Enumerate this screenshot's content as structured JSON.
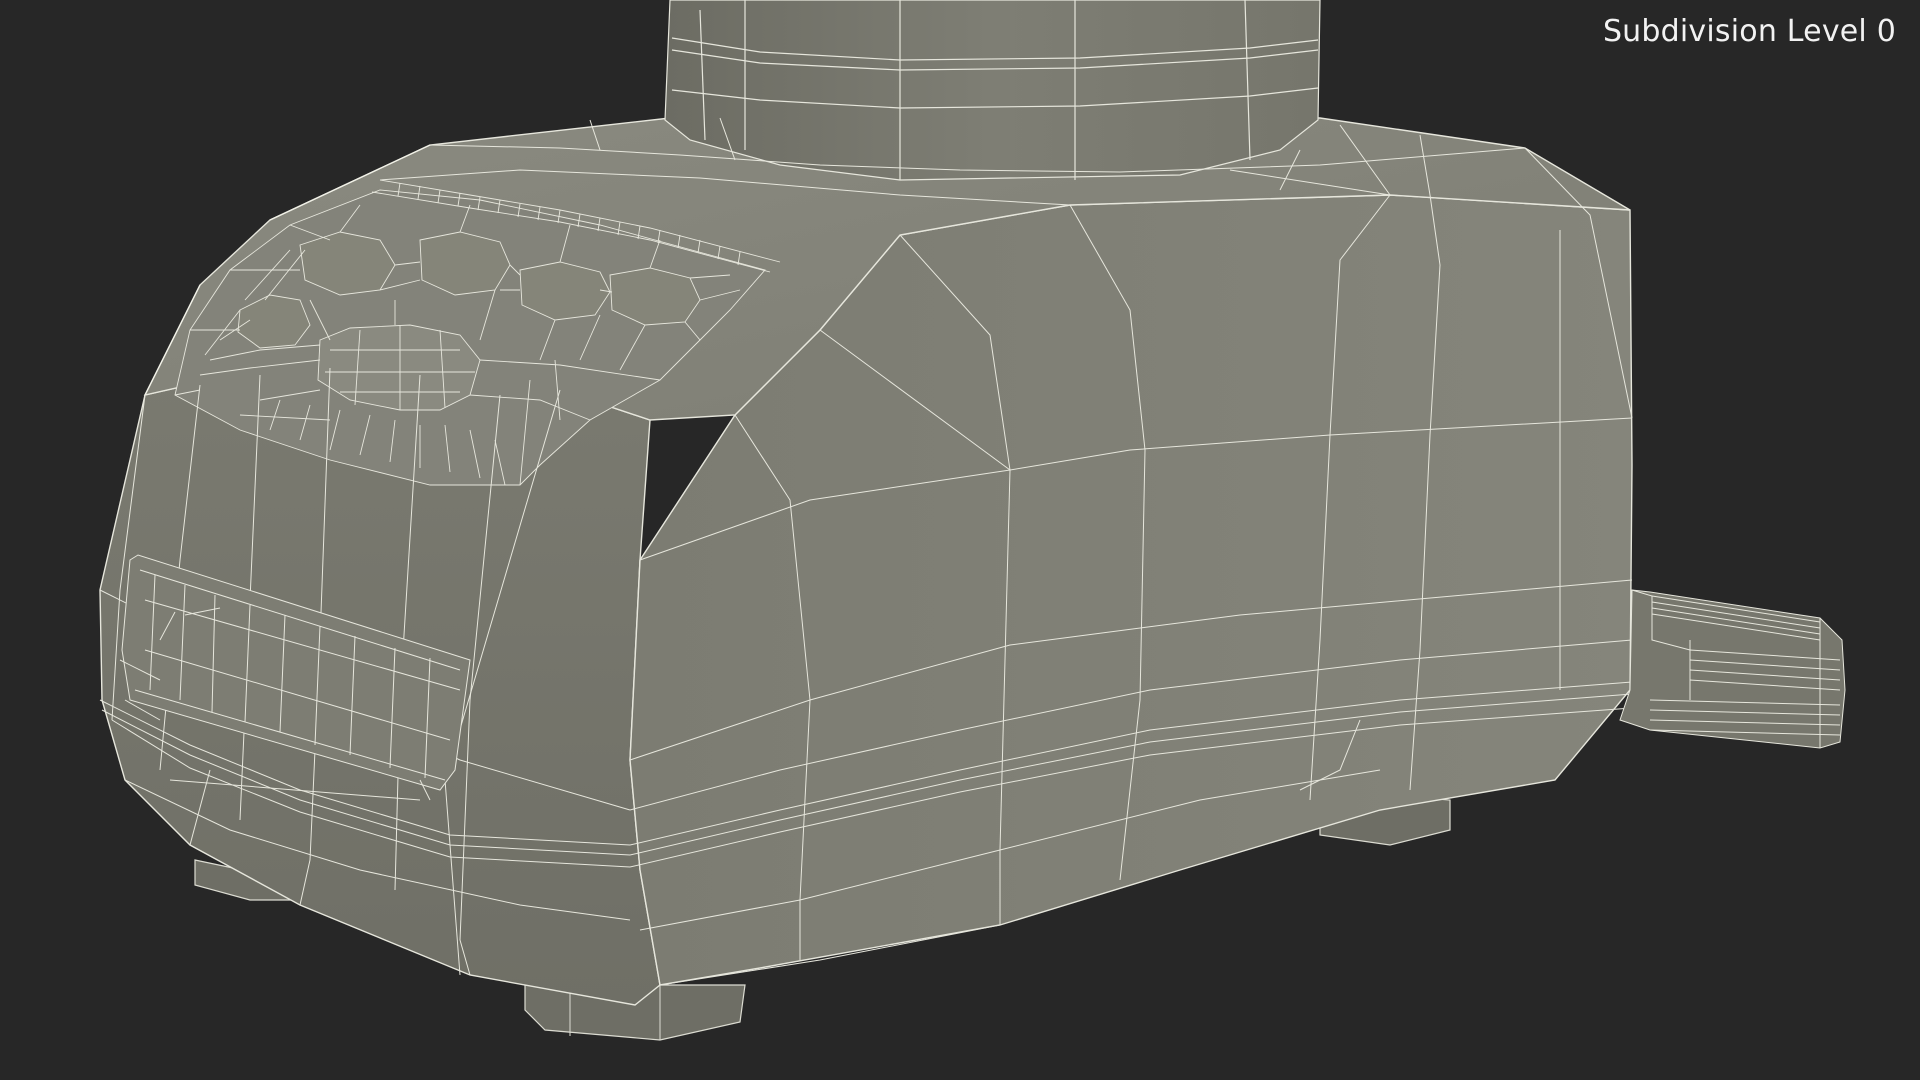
{
  "viewport": {
    "label": "Subdivision Level 0",
    "background_color": "#272727"
  },
  "model": {
    "subject": "blender-base-wireframe",
    "surface_color": "#7a7a70",
    "wire_color": "#e6e6dc"
  }
}
